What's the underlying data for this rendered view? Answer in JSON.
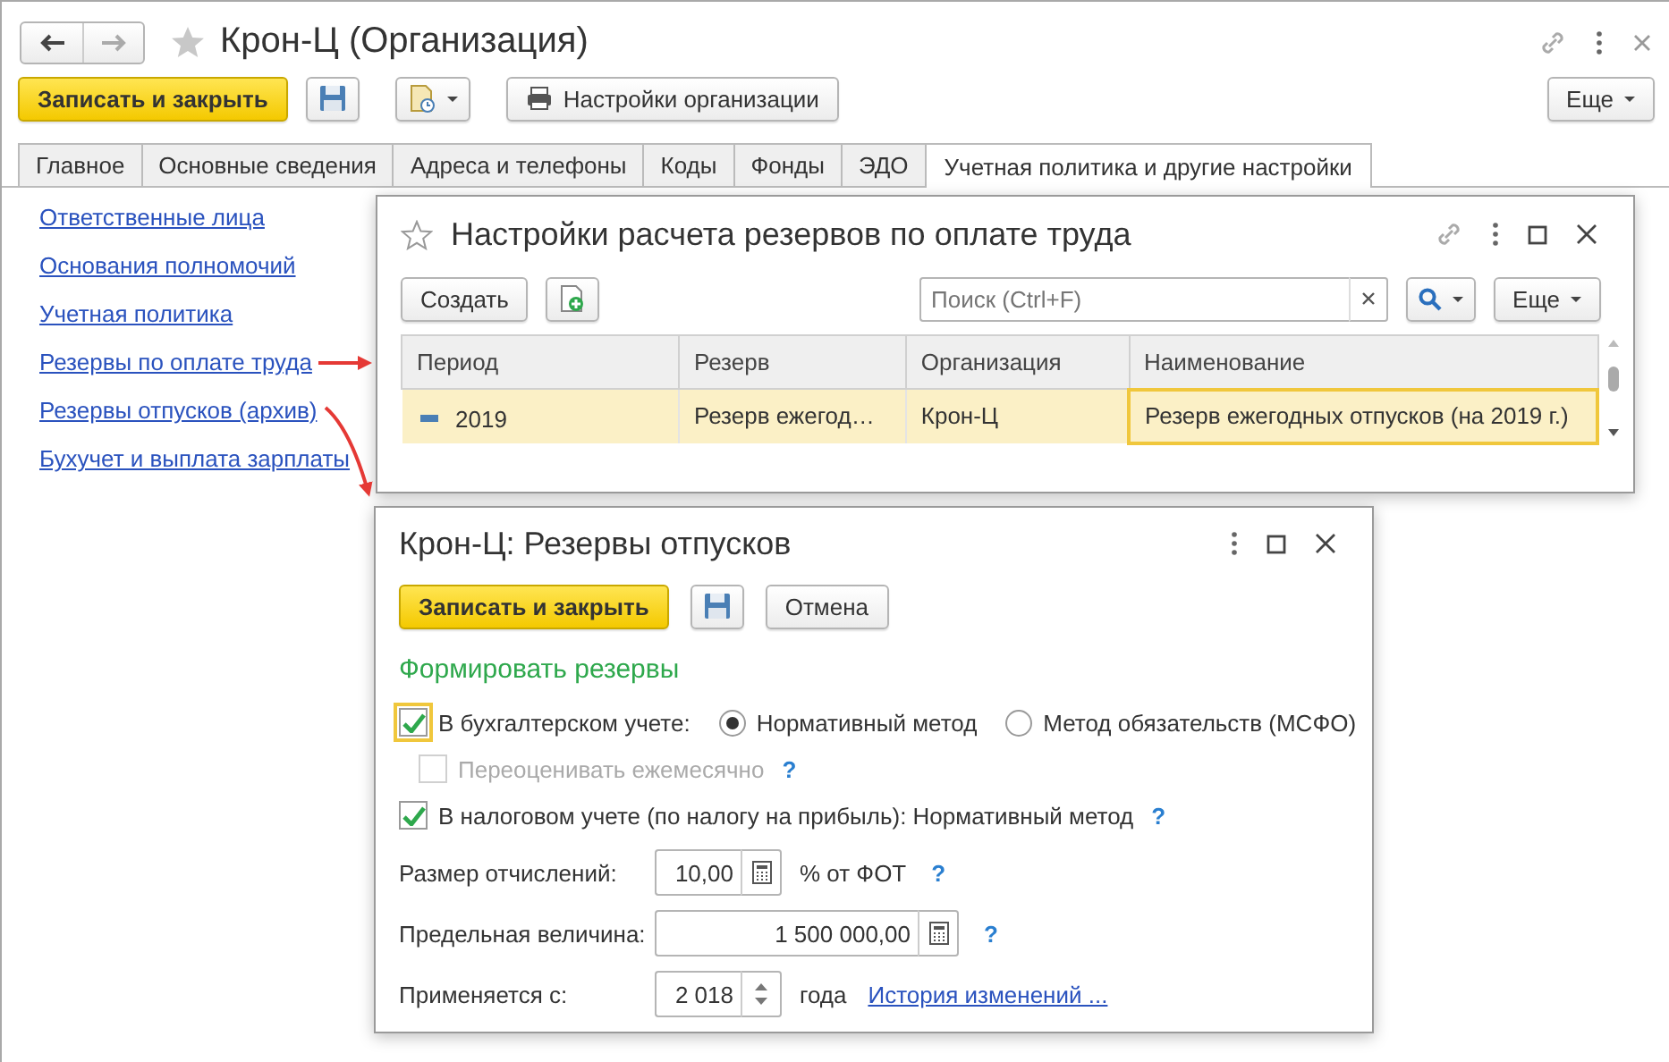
{
  "window": {
    "title": "Крон-Ц (Организация)"
  },
  "toolbar": {
    "save_close": "Записать и закрыть",
    "settings": "Настройки организации",
    "more": "Еще"
  },
  "tabs": [
    {
      "label": "Главное",
      "selected": false
    },
    {
      "label": "Основные сведения",
      "selected": false
    },
    {
      "label": "Адреса и телефоны",
      "selected": false
    },
    {
      "label": "Коды",
      "selected": false
    },
    {
      "label": "Фонды",
      "selected": false
    },
    {
      "label": "ЭДО",
      "selected": false
    },
    {
      "label": "Учетная политика и другие настройки",
      "selected": true
    }
  ],
  "links": [
    "Ответственные лица",
    "Основания полномочий",
    "Учетная политика",
    "Резервы по оплате труда",
    "Резервы отпусков (архив)",
    "Бухучет и выплата зарплаты"
  ],
  "list_dialog": {
    "title": "Настройки расчета резервов по оплате труда",
    "create": "Создать",
    "search": {
      "placeholder": "Поиск (Ctrl+F)"
    },
    "more": "Еще",
    "columns": [
      "Период",
      "Резерв",
      "Организация",
      "Наименование"
    ],
    "rows": [
      {
        "period": "2019",
        "reserve": "Резерв ежегод…",
        "organization": "Крон-Ц",
        "name": "Резерв ежегодных отпусков (на 2019 г.)",
        "selected": true
      }
    ]
  },
  "reserve_dialog": {
    "title": "Крон-Ц: Резервы отпусков",
    "save_close": "Записать и закрыть",
    "cancel": "Отмена",
    "section": "Формировать резервы",
    "accounting": {
      "label": "В бухгалтерском учете:",
      "checked": true
    },
    "methods": [
      {
        "label": "Нормативный метод",
        "selected": true
      },
      {
        "label": "Метод обязательств (МСФО)",
        "selected": false
      }
    ],
    "revalue": {
      "label": "Переоценивать ежемесячно",
      "checked": false,
      "disabled": true,
      "help": "?"
    },
    "tax": {
      "label": "В налоговом учете (по налогу на прибыль): Нормативный метод",
      "checked": true,
      "help": "?"
    },
    "rate": {
      "label": "Размер отчислений:",
      "value": "10,00",
      "unit": "% от ФОТ",
      "help": "?"
    },
    "limit": {
      "label": "Предельная величина:",
      "value": "1 500 000,00",
      "help": "?"
    },
    "applies": {
      "label": "Применяется с:",
      "value": "2 018",
      "unit": "года",
      "link": "История изменений ..."
    }
  }
}
